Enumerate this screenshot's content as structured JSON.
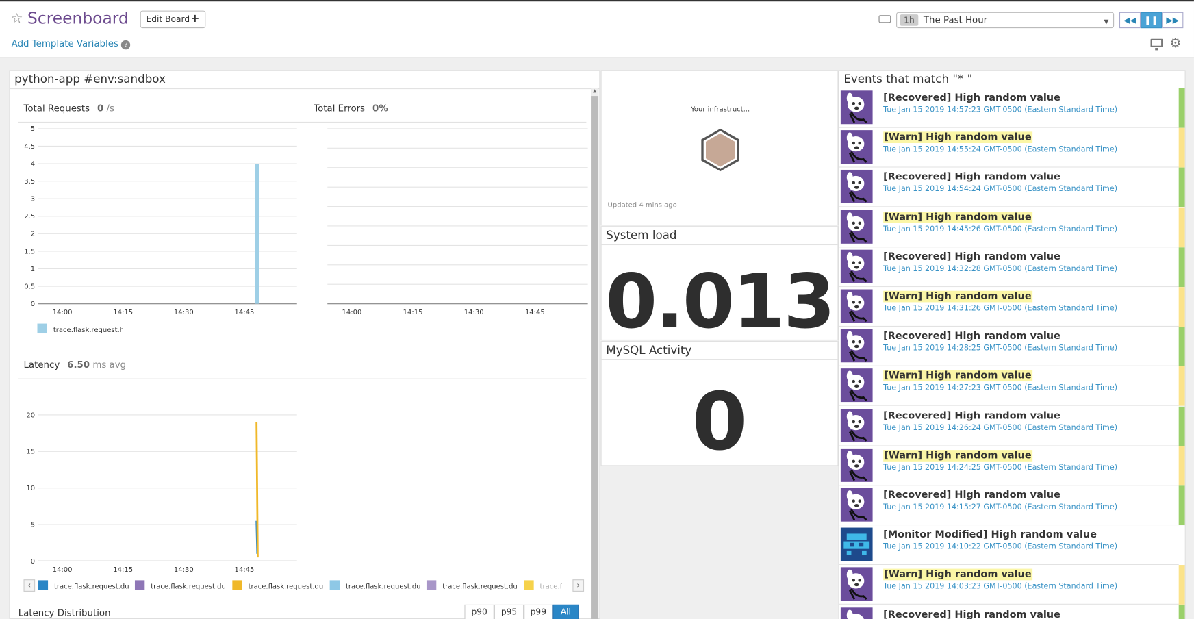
{
  "header": {
    "title": "Screenboard",
    "edit_label": "Edit Board",
    "template_vars_label": "Add Template Variables",
    "time_tag": "1h",
    "time_label": "The Past Hour"
  },
  "group": {
    "title": "python-app #env:sandbox",
    "total_requests": {
      "label": "Total Requests",
      "value": "0",
      "unit": "/s"
    },
    "total_errors": {
      "label": "Total Errors",
      "value": "0%"
    },
    "latency": {
      "label": "Latency",
      "value": "6.50",
      "unit": "ms avg"
    },
    "latency_dist_label": "Latency Distribution",
    "percentile_buttons": [
      "p90",
      "p95",
      "p99",
      "All"
    ]
  },
  "hostmap": {
    "title": "Your infrastruct...",
    "updated": "Updated 4 mins ago"
  },
  "system_load": {
    "title": "System load",
    "value": "0.013"
  },
  "mysql": {
    "title": "MySQL Activity",
    "value": "0"
  },
  "events": {
    "title": "Events that match \"* \"",
    "items": [
      {
        "title": "[Recovered] High random value",
        "date": "Tue Jan 15 2019 14:57:23 GMT-0500 (Eastern Standard Time)",
        "status": "recovered"
      },
      {
        "title": "[Warn] High random value",
        "date": "Tue Jan 15 2019 14:55:24 GMT-0500 (Eastern Standard Time)",
        "status": "warn"
      },
      {
        "title": "[Recovered] High random value",
        "date": "Tue Jan 15 2019 14:54:24 GMT-0500 (Eastern Standard Time)",
        "status": "recovered"
      },
      {
        "title": "[Warn] High random value",
        "date": "Tue Jan 15 2019 14:45:26 GMT-0500 (Eastern Standard Time)",
        "status": "warn"
      },
      {
        "title": "[Recovered] High random value",
        "date": "Tue Jan 15 2019 14:32:28 GMT-0500 (Eastern Standard Time)",
        "status": "recovered"
      },
      {
        "title": "[Warn] High random value",
        "date": "Tue Jan 15 2019 14:31:26 GMT-0500 (Eastern Standard Time)",
        "status": "warn"
      },
      {
        "title": "[Recovered] High random value",
        "date": "Tue Jan 15 2019 14:28:25 GMT-0500 (Eastern Standard Time)",
        "status": "recovered"
      },
      {
        "title": "[Warn] High random value",
        "date": "Tue Jan 15 2019 14:27:23 GMT-0500 (Eastern Standard Time)",
        "status": "warn"
      },
      {
        "title": "[Recovered] High random value",
        "date": "Tue Jan 15 2019 14:26:24 GMT-0500 (Eastern Standard Time)",
        "status": "recovered"
      },
      {
        "title": "[Warn] High random value",
        "date": "Tue Jan 15 2019 14:24:25 GMT-0500 (Eastern Standard Time)",
        "status": "warn"
      },
      {
        "title": "[Recovered] High random value",
        "date": "Tue Jan 15 2019 14:15:27 GMT-0500 (Eastern Standard Time)",
        "status": "recovered"
      },
      {
        "title": "[Monitor Modified] High random value",
        "date": "Tue Jan 15 2019 14:10:22 GMT-0500 (Eastern Standard Time)",
        "status": "modified"
      },
      {
        "title": "[Warn] High random value",
        "date": "Tue Jan 15 2019 14:03:23 GMT-0500 (Eastern Standard Time)",
        "status": "warn"
      },
      {
        "title": "[Recovered] High random value",
        "date": "",
        "status": "recovered"
      }
    ]
  },
  "colors": {
    "recovered": "#9ad06a",
    "warn": "#fbe38a",
    "modified": "#ffffff"
  },
  "chart_data": [
    {
      "type": "bar",
      "x_ticks": [
        "14:00",
        "14:15",
        "14:30",
        "14:45"
      ],
      "y_ticks": [
        "0",
        "0.5",
        "1",
        "1.5",
        "2",
        "2.5",
        "3",
        "3.5",
        "4",
        "4.5",
        "5"
      ],
      "ylim": [
        0,
        5
      ],
      "xlim_minutes": [
        -6,
        58
      ],
      "bars": [
        {
          "x_minutes": 48,
          "value": 4
        }
      ],
      "series": [
        {
          "name": "trace.flask.request.hit",
          "color": "#9ecfe6"
        }
      ]
    },
    {
      "type": "line",
      "x_ticks": [
        "14:00",
        "14:15",
        "14:30",
        "14:45"
      ],
      "values": []
    },
    {
      "type": "line",
      "x_ticks": [
        "14:00",
        "14:15",
        "14:30",
        "14:45"
      ],
      "y_ticks": [
        "0",
        "5",
        "10",
        "15",
        "20"
      ],
      "ylim": [
        0,
        20
      ],
      "xlim_minutes": [
        -6,
        58
      ],
      "series": [
        {
          "name": "trace.flask.request.du",
          "color": "#2a86c6",
          "points": [
            [
              48,
              5.5
            ],
            [
              48.2,
              1
            ]
          ]
        },
        {
          "name": "trace.flask.request.du",
          "color": "#8e76b6",
          "points": []
        },
        {
          "name": "trace.flask.request.du",
          "color": "#f0b829",
          "points": [
            [
              48,
              19
            ],
            [
              48.3,
              0.5
            ]
          ]
        },
        {
          "name": "trace.flask.request.du",
          "color": "#8ec8e6",
          "points": []
        },
        {
          "name": "trace.flask.request.du",
          "color": "#a896c8",
          "points": []
        },
        {
          "name": "trace.fla",
          "color": "#f6d24a",
          "points": []
        }
      ]
    }
  ]
}
